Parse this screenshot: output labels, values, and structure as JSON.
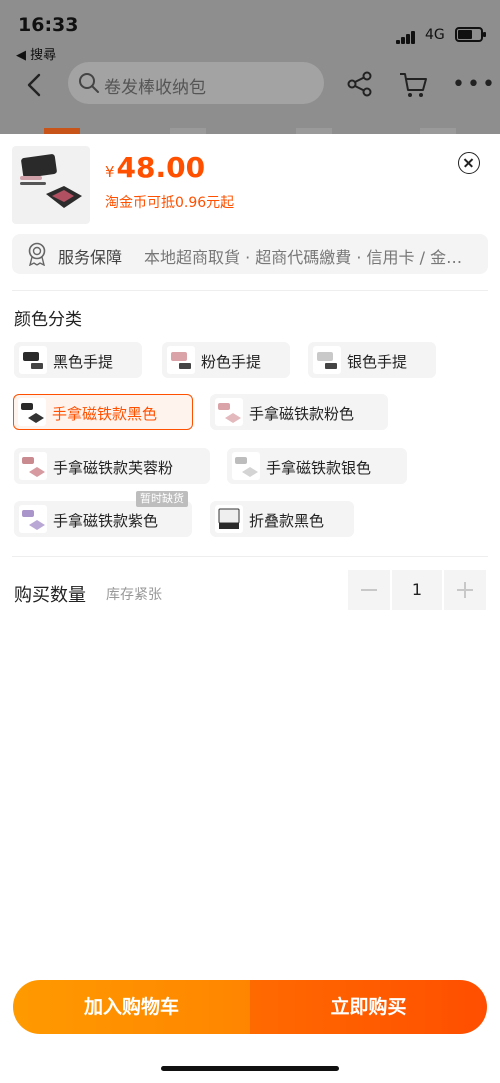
{
  "status_bar": {
    "time": "16:33",
    "back_app": "◀ 搜尋",
    "network": "4G"
  },
  "background": {
    "search_placeholder": "卷发棒收纳包"
  },
  "product": {
    "currency": "¥",
    "price": "48.00",
    "coin_text": "淘金币可抵0.96元起"
  },
  "service": {
    "title": "服务保障",
    "desc": "本地超商取貨 · 超商代碼繳費 · 信用卡 / 金…"
  },
  "variants": {
    "title": "颜色分类",
    "options": [
      {
        "label": "黑色手提",
        "thumb": "black-handbag"
      },
      {
        "label": "粉色手提",
        "thumb": "pink-handbag"
      },
      {
        "label": "银色手提",
        "thumb": "silver-handbag"
      },
      {
        "label": "手拿磁铁款黑色",
        "thumb": "black-clutch",
        "selected": true
      },
      {
        "label": "手拿磁铁款粉色",
        "thumb": "pink-clutch"
      },
      {
        "label": "手拿磁铁款芙蓉粉",
        "thumb": "rose-clutch"
      },
      {
        "label": "手拿磁铁款银色",
        "thumb": "silver-clutch"
      },
      {
        "label": "手拿磁铁款紫色",
        "thumb": "purple-clutch"
      },
      {
        "label": "折叠款黑色",
        "thumb": "folding-black"
      }
    ],
    "out_of_stock_badge": "暂时缺货"
  },
  "quantity": {
    "label": "购买数量",
    "hint": "库存紧张",
    "value": "1"
  },
  "actions": {
    "add_to_cart": "加入购物车",
    "buy_now": "立即购买"
  },
  "colors": {
    "accent": "#ff5000",
    "cart_button": "#ff9000",
    "buy_button": "#ff5500"
  }
}
